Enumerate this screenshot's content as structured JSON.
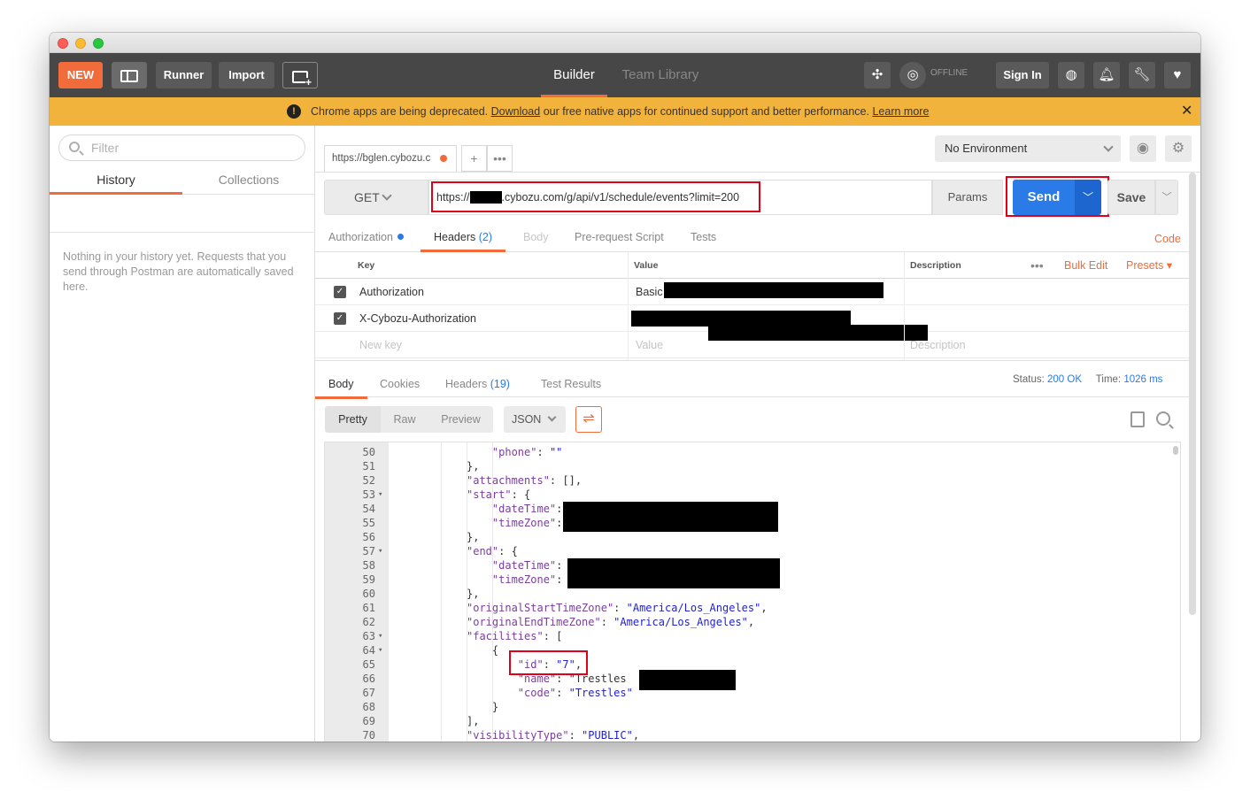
{
  "topbar": {
    "new_label": "NEW",
    "runner_label": "Runner",
    "import_label": "Import",
    "tab_builder": "Builder",
    "tab_team_library": "Team Library",
    "offline_label": "OFFLINE",
    "signin_label": "Sign In"
  },
  "banner": {
    "text_before": "Chrome apps are being deprecated.",
    "download_link": "Download",
    "text_after": "our free native apps for continued support and better performance.",
    "learn_more": "Learn more",
    "close": "✕"
  },
  "sidebar": {
    "filter_placeholder": "Filter",
    "tabs": [
      "History",
      "Collections"
    ],
    "empty_message": "Nothing in your history yet. Requests that you send through Postman are automatically saved here."
  },
  "request_tab": {
    "label": "https://bglen.cybozu.c"
  },
  "environment": {
    "selected": "No Environment"
  },
  "request": {
    "method": "GET",
    "url_prefix": "https://",
    "url_rest": ".cybozu.com/g/api/v1/schedule/events?limit=200",
    "params_label": "Params",
    "send_label": "Send",
    "save_label": "Save"
  },
  "request_tabs": {
    "authorization": "Authorization",
    "headers": "Headers",
    "headers_count": "(2)",
    "body": "Body",
    "pre_request": "Pre-request Script",
    "tests": "Tests",
    "code": "Code"
  },
  "headers_table": {
    "col_key": "Key",
    "col_value": "Value",
    "col_description": "Description",
    "bulk_edit": "Bulk Edit",
    "presets": "Presets ▾",
    "rows": [
      {
        "key": "Authorization",
        "value": "Basic"
      },
      {
        "key": "X-Cybozu-Authorization",
        "value": ""
      }
    ],
    "new_key_placeholder": "New key",
    "value_placeholder": "Value",
    "description_placeholder": "Description"
  },
  "response": {
    "tabs": {
      "body": "Body",
      "cookies": "Cookies",
      "headers": "Headers",
      "headers_count": "(19)",
      "test_results": "Test Results"
    },
    "status_label": "Status:",
    "status_value": "200 OK",
    "time_label": "Time:",
    "time_value": "1026 ms",
    "formats": [
      "Pretty",
      "Raw",
      "Preview"
    ],
    "format_selected": "JSON"
  },
  "editor_lines": [
    {
      "n": "50",
      "text": "    \"phone\": \"\""
    },
    {
      "n": "51",
      "text": "},"
    },
    {
      "n": "52",
      "text": "\"attachments\": [],"
    },
    {
      "n": "53",
      "text": "\"start\": {"
    },
    {
      "n": "54",
      "text": "    \"dateTime\":"
    },
    {
      "n": "55",
      "text": "    \"timeZone\":"
    },
    {
      "n": "56",
      "text": "},"
    },
    {
      "n": "57",
      "text": "\"end\": {"
    },
    {
      "n": "58",
      "text": "    \"dateTime\":"
    },
    {
      "n": "59",
      "text": "    \"timeZone\":"
    },
    {
      "n": "60",
      "text": "},"
    },
    {
      "n": "61",
      "text": "\"originalStartTimeZone\": \"America/Los_Angeles\","
    },
    {
      "n": "62",
      "text": "\"originalEndTimeZone\": \"America/Los_Angeles\","
    },
    {
      "n": "63",
      "text": "\"facilities\": ["
    },
    {
      "n": "64",
      "text": "    {"
    },
    {
      "n": "65",
      "text": "        \"id\": \"7\","
    },
    {
      "n": "66",
      "text": "        \"name\": \"Trestles"
    },
    {
      "n": "67",
      "text": "        \"code\": \"Trestles\""
    },
    {
      "n": "68",
      "text": "    }"
    },
    {
      "n": "69",
      "text": "],"
    },
    {
      "n": "70",
      "text": "\"visibilityType\": \"PUBLIC\","
    }
  ]
}
